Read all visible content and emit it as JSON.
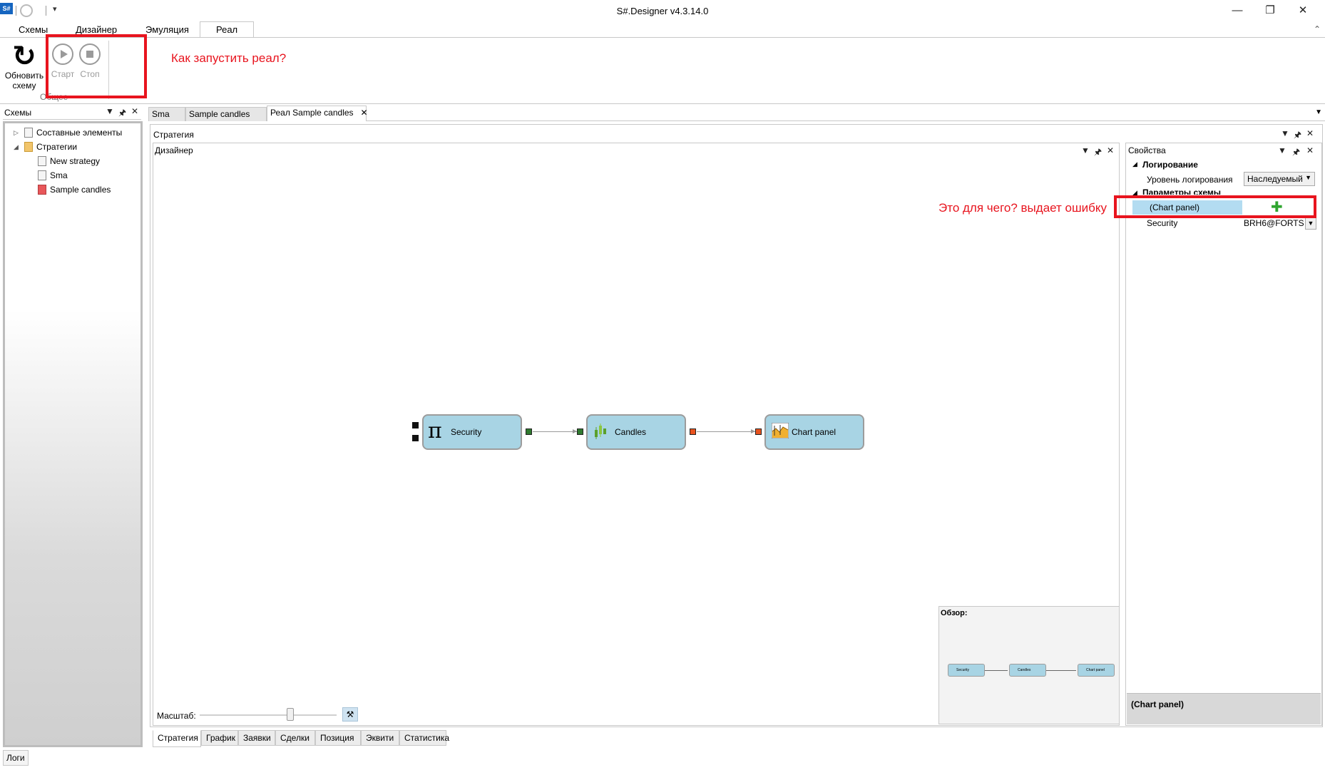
{
  "window": {
    "title": "S#.Designer v4.3.14.0",
    "logo": "S#",
    "qat_dropdown": "▾"
  },
  "ribbon": {
    "tabs": [
      "Схемы",
      "Дизайнер",
      "Эмуляция",
      "Реал"
    ],
    "active_tab": "Реал",
    "refresh_line1": "Обновить",
    "refresh_line2": "схему",
    "start": "Старт",
    "stop": "Стоп",
    "group_label": "Общее"
  },
  "annotations": {
    "run_real": "Как запустить реал?",
    "what_for": "Это для чего? выдает ошибку"
  },
  "schemes": {
    "title": "Схемы",
    "tree": [
      {
        "label": "Составные элементы",
        "level": 0,
        "icon": "doc-icon"
      },
      {
        "label": "Стратегии",
        "level": 0,
        "icon": "folder-icon"
      },
      {
        "label": "New strategy",
        "level": 1,
        "icon": "doc-icon"
      },
      {
        "label": "Sma",
        "level": 1,
        "icon": "doc-icon"
      },
      {
        "label": "Sample candles",
        "level": 1,
        "icon": "red-doc-icon"
      }
    ]
  },
  "doc_tabs": [
    "Sma",
    "Sample candles",
    "Реал Sample candles"
  ],
  "strategy": {
    "title": "Стратегия",
    "designer_title": "Дизайнер"
  },
  "diagram": {
    "nodes": [
      "Security",
      "Candles",
      "Chart panel"
    ],
    "overview_title": "Обзор:",
    "zoom_label": "Масштаб:"
  },
  "properties": {
    "title": "Свойства",
    "category_logging": "Логирование",
    "logging_level_label": "Уровень логирования",
    "logging_level_value": "Наследуемый",
    "category_params": "Параметры схемы",
    "chart_panel_label": "(Chart panel)",
    "security_label": "Security",
    "security_value": "BRH6@FORTS",
    "description_title": "(Chart panel)"
  },
  "bottom_tabs": [
    "Стратегия",
    "График",
    "Заявки",
    "Сделки",
    "Позиция",
    "Эквити",
    "Статистика"
  ],
  "logs_tab": "Логи",
  "colors": {
    "annotation": "#e8141e",
    "node_fill": "#a8d4e4",
    "selection": "#b3dcf1"
  }
}
